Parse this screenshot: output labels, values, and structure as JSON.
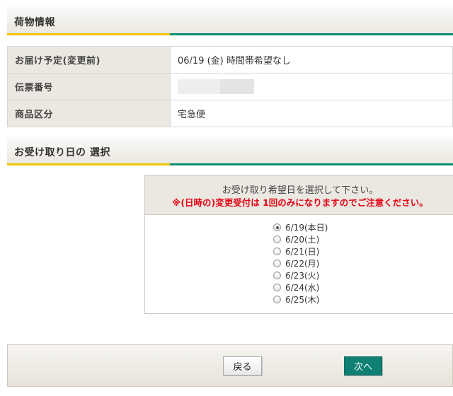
{
  "package_section": {
    "title": "荷物情報",
    "rows": [
      {
        "label": "お届け予定(変更前)",
        "value": "06/19 (金) 時間帯希望なし"
      },
      {
        "label": "伝票番号",
        "value": ""
      },
      {
        "label": "商品区分",
        "value": "宅急便"
      }
    ]
  },
  "date_section": {
    "title": "お受け取り日の 選択",
    "instruction": "お受け取り希望日を選択して下さい。",
    "warning": "※(日時の)変更受付は 1回のみになりますのでご注意ください。",
    "options": [
      {
        "label": "6/19(本日)",
        "checked": true
      },
      {
        "label": "6/20(土)",
        "checked": false
      },
      {
        "label": "6/21(日)",
        "checked": false
      },
      {
        "label": "6/22(月)",
        "checked": false
      },
      {
        "label": "6/23(火)",
        "checked": false
      },
      {
        "label": "6/24(水)",
        "checked": false
      },
      {
        "label": "6/25(木)",
        "checked": false
      }
    ]
  },
  "footer": {
    "back_label": "戻る",
    "next_label": "次へ"
  },
  "colors": {
    "accent_yellow": "#f0c300",
    "accent_green": "#0d8b73",
    "next_button": "#0e7f73",
    "warning_text": "#e60012"
  }
}
